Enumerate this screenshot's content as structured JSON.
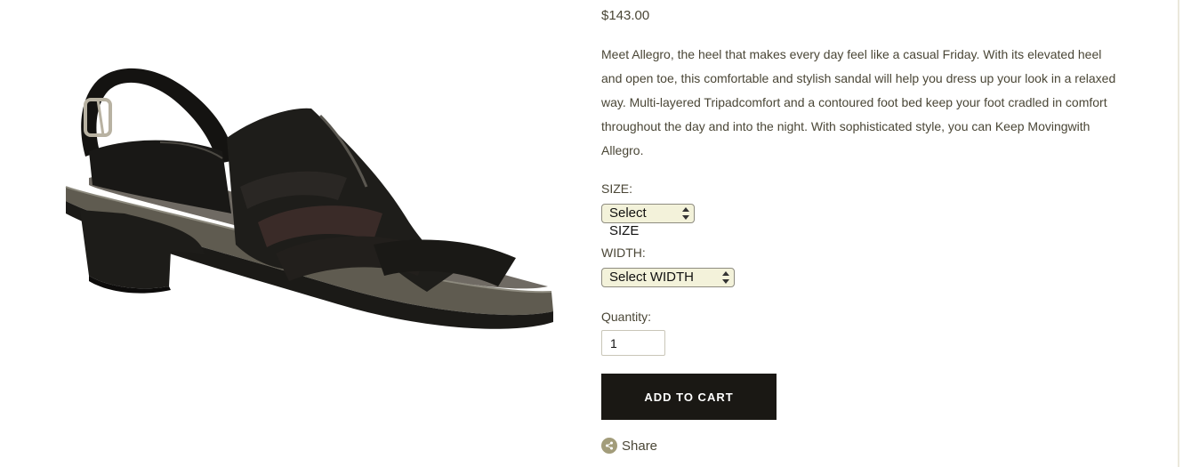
{
  "product": {
    "price": "$143.00",
    "description": "Meet Allegro, the heel that makes every day feel like a casual Friday. With its elevated heel and open toe, this comfortable and stylish sandal will help you dress up your look in a relaxed way. Multi-layered Tripadcomfort and a contoured foot bed keep your foot cradled in comfort throughout the day and into the night. With sophisticated style, you can Keep Movingwith Allegro.",
    "image_alt": "Black leather T-strap heeled sandal"
  },
  "options": {
    "size_label": "SIZE:",
    "size_selected": "Select SIZE",
    "width_label": "WIDTH:",
    "width_selected": "Select WIDTH",
    "quantity_label": "Quantity:",
    "quantity_value": "1"
  },
  "actions": {
    "add_to_cart": "ADD TO CART",
    "share": "Share"
  },
  "icons": {
    "share": "share-icon",
    "select_arrows": "updown-arrows-icon"
  },
  "colors": {
    "button_bg": "#1a1814",
    "select_bg": "#f3f2da",
    "text": "#4a4636",
    "share_icon": "#a29c7a"
  }
}
